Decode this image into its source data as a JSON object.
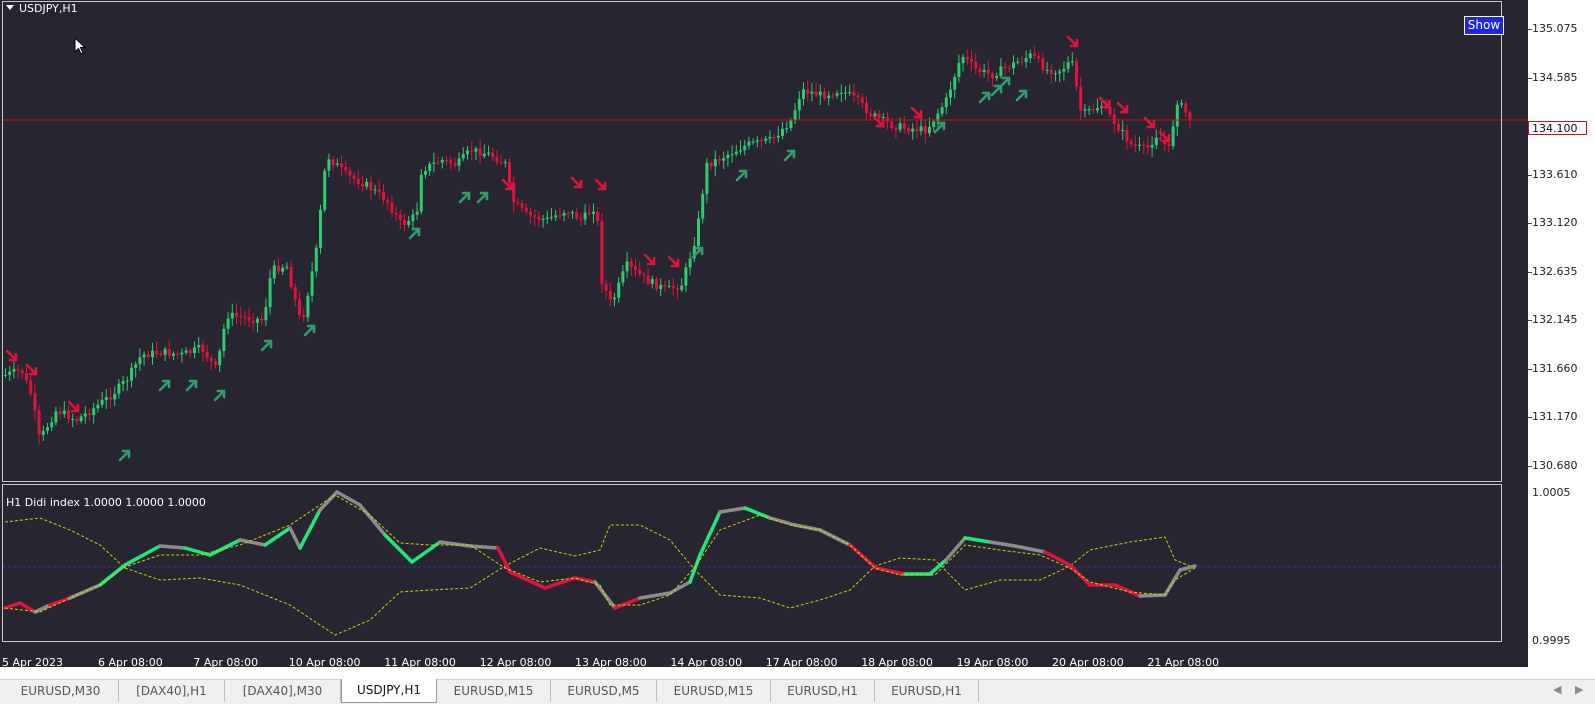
{
  "chart": {
    "symbol_label": "USDJPY,H1",
    "show_button": "Show",
    "current_price_label": "134.100",
    "price_ticks": [
      "135.075",
      "134.585",
      "134.100",
      "133.610",
      "133.120",
      "132.635",
      "132.145",
      "131.660",
      "131.170",
      "130.680"
    ],
    "time_labels": [
      "5 Apr 2023",
      "6 Apr 08:00",
      "7 Apr 08:00",
      "10 Apr 08:00",
      "11 Apr 08:00",
      "12 Apr 08:00",
      "13 Apr 08:00",
      "14 Apr 08:00",
      "17 Apr 08:00",
      "18 Apr 08:00",
      "19 Apr 08:00",
      "20 Apr 08:00",
      "21 Apr 08:00"
    ],
    "colors": {
      "background": "#282532",
      "bull": "#2ecc71",
      "bear": "#e0133c",
      "price_line": "#cc1111",
      "buy_arrow": "#2e9e6c",
      "sell_arrow": "#e0133c"
    }
  },
  "indicator": {
    "label": "H1 Didi index 1.0000 1.0000 1.0000",
    "ticks": [
      "1.0005",
      "0.9995"
    ],
    "colors": {
      "up": "#1ee878",
      "down": "#e0133c",
      "neutral": "#8c8c8c",
      "band": "#d8d000",
      "mid": "#3030a0"
    }
  },
  "tabs": [
    {
      "label": "EURUSD,M30",
      "active": false
    },
    {
      "label": "[DAX40],H1",
      "active": false
    },
    {
      "label": "[DAX40],M30",
      "active": false
    },
    {
      "label": "USDJPY,H1",
      "active": true
    },
    {
      "label": "EURUSD,M15",
      "active": false
    },
    {
      "label": "EURUSD,M5",
      "active": false
    },
    {
      "label": "EURUSD,M15",
      "active": false
    },
    {
      "label": "EURUSD,H1",
      "active": false
    },
    {
      "label": "EURUSD,H1",
      "active": false
    }
  ],
  "nav": {
    "left": "◀",
    "right": "▶"
  }
}
